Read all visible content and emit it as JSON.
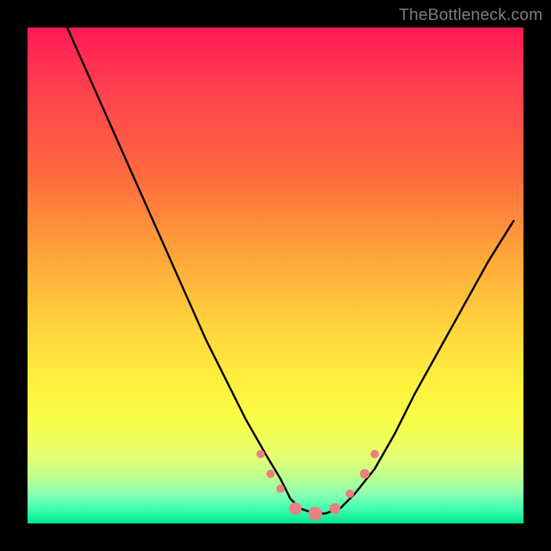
{
  "attribution": "TheBottleneck.com",
  "chart_data": {
    "type": "line",
    "title": "",
    "xlabel": "",
    "ylabel": "",
    "xlim": [
      0,
      100
    ],
    "ylim": [
      0,
      100
    ],
    "series": [
      {
        "name": "bottleneck-curve",
        "x": [
          8,
          12,
          16,
          20,
          24,
          28,
          32,
          36,
          40,
          44,
          48,
          51,
          53,
          55,
          58,
          60,
          63,
          66,
          70,
          74,
          78,
          83,
          88,
          93,
          98
        ],
        "y": [
          100,
          91,
          82,
          73,
          64,
          55,
          46,
          37,
          29,
          21,
          14,
          9,
          5,
          3,
          2,
          2,
          3,
          6,
          11,
          18,
          26,
          35,
          44,
          53,
          61
        ]
      }
    ],
    "markers": {
      "name": "highlight-points",
      "color": "#e98080",
      "points": [
        {
          "x": 47,
          "y": 14,
          "r": 6
        },
        {
          "x": 49,
          "y": 10,
          "r": 6
        },
        {
          "x": 51,
          "y": 7,
          "r": 6
        },
        {
          "x": 54,
          "y": 3,
          "r": 9
        },
        {
          "x": 58,
          "y": 2,
          "r": 10
        },
        {
          "x": 62,
          "y": 3,
          "r": 8
        },
        {
          "x": 65,
          "y": 6,
          "r": 6
        },
        {
          "x": 68,
          "y": 10,
          "r": 7
        },
        {
          "x": 70,
          "y": 14,
          "r": 6
        }
      ]
    }
  }
}
